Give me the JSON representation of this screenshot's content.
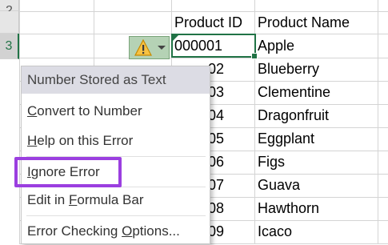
{
  "row_headers": [
    "2",
    "3"
  ],
  "headers": {
    "product_id": "Product ID",
    "product_name": "Product Name"
  },
  "rows": [
    {
      "id_visible": "000001",
      "name": "Apple"
    },
    {
      "id_visible": "02",
      "name": "Blueberry"
    },
    {
      "id_visible": "03",
      "name": "Clementine"
    },
    {
      "id_visible": "04",
      "name": "Dragonfruit"
    },
    {
      "id_visible": "05",
      "name": "Eggplant"
    },
    {
      "id_visible": "06",
      "name": "Figs"
    },
    {
      "id_visible": "07",
      "name": "Guava"
    },
    {
      "id_visible": "08",
      "name": "Hawthorn"
    },
    {
      "id_visible": "09",
      "name": "Icaco"
    }
  ],
  "error_button": {
    "icon": "warning-icon",
    "dropdown_icon": "chevron-down-icon"
  },
  "menu": {
    "title": "Number Stored as Text",
    "items": [
      {
        "label_pre": "",
        "label_ul": "C",
        "label_post": "onvert to Number"
      },
      {
        "label_pre": "",
        "label_ul": "H",
        "label_post": "elp on this Error"
      },
      {
        "label_pre": "",
        "label_ul": "I",
        "label_post": "gnore Error"
      },
      {
        "label_pre": "Edit in ",
        "label_ul": "F",
        "label_post": "ormula Bar"
      },
      {
        "label_pre": "Error Checking ",
        "label_ul": "O",
        "label_post": "ptions..."
      }
    ]
  },
  "colors": {
    "accent": "#217346",
    "highlight_box": "#9b3fe0",
    "menu_header_bg": "#dcdce4"
  }
}
